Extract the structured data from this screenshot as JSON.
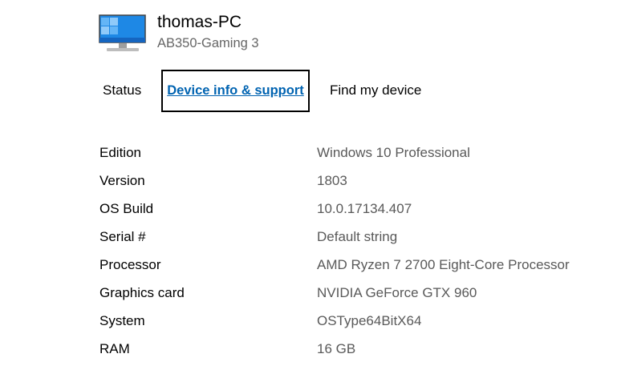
{
  "device": {
    "name": "thomas-PC",
    "model": "AB350-Gaming 3",
    "icon": "monitor-icon"
  },
  "tabs": [
    {
      "label": "Status",
      "selected": false
    },
    {
      "label": "Device info & support",
      "selected": true
    },
    {
      "label": "Find my device",
      "selected": false
    }
  ],
  "specs": [
    {
      "label": "Edition",
      "value": "Windows 10 Professional"
    },
    {
      "label": "Version",
      "value": "1803"
    },
    {
      "label": "OS Build",
      "value": "10.0.17134.407"
    },
    {
      "label": "Serial #",
      "value": "Default string"
    },
    {
      "label": "Processor",
      "value": "AMD Ryzen 7 2700 Eight-Core Processor"
    },
    {
      "label": "Graphics card",
      "value": "NVIDIA GeForce GTX 960"
    },
    {
      "label": "System",
      "value": "OSType64BitX64"
    },
    {
      "label": "RAM",
      "value": "16 GB"
    }
  ],
  "colors": {
    "accent": "#0063b1",
    "monitor_screen": "#1e88e5",
    "value_text": "#595959"
  }
}
